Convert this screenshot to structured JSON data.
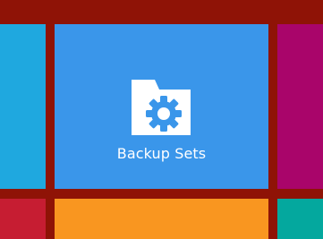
{
  "tiles": {
    "main": {
      "label": "Backup Sets",
      "icon": "folder-gear-icon",
      "color": "#3a96ea"
    },
    "left_top": {
      "color": "#1fa8df"
    },
    "right_top": {
      "color": "#a9056a"
    },
    "bottom_left": {
      "color": "#c61d32"
    },
    "bottom_middle": {
      "color": "#f99620"
    },
    "bottom_right": {
      "color": "#04a89e"
    }
  },
  "background_color": "#8f1306"
}
